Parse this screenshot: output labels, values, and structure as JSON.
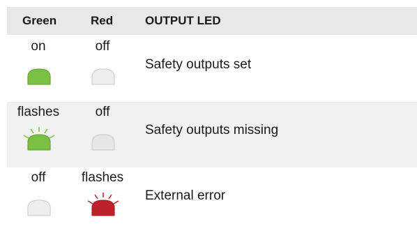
{
  "header": {
    "green": "Green",
    "red": "Red",
    "output_led": "OUTPUT LED"
  },
  "rows": [
    {
      "green": "on",
      "red": "off",
      "desc": "Safety outputs set",
      "green_led": "on",
      "red_led": "off"
    },
    {
      "green": "flashes",
      "red": "off",
      "desc": "Safety outputs missing",
      "green_led": "flashes",
      "red_led": "off"
    },
    {
      "green": "off",
      "red": "flashes",
      "desc": "External error",
      "green_led": "off",
      "red_led": "flashes"
    }
  ],
  "colors": {
    "green_led": "#7ac143",
    "red_led": "#c0202a",
    "off_fill": "#e6e6e6",
    "off_stroke": "#c8c8c8",
    "header_bg": "#e8e8e8",
    "shade_bg": "#f1f1f1"
  },
  "icons": {
    "led_on": "led-dome-icon",
    "led_flash": "led-flash-icon",
    "led_off": "led-dome-off-icon"
  }
}
